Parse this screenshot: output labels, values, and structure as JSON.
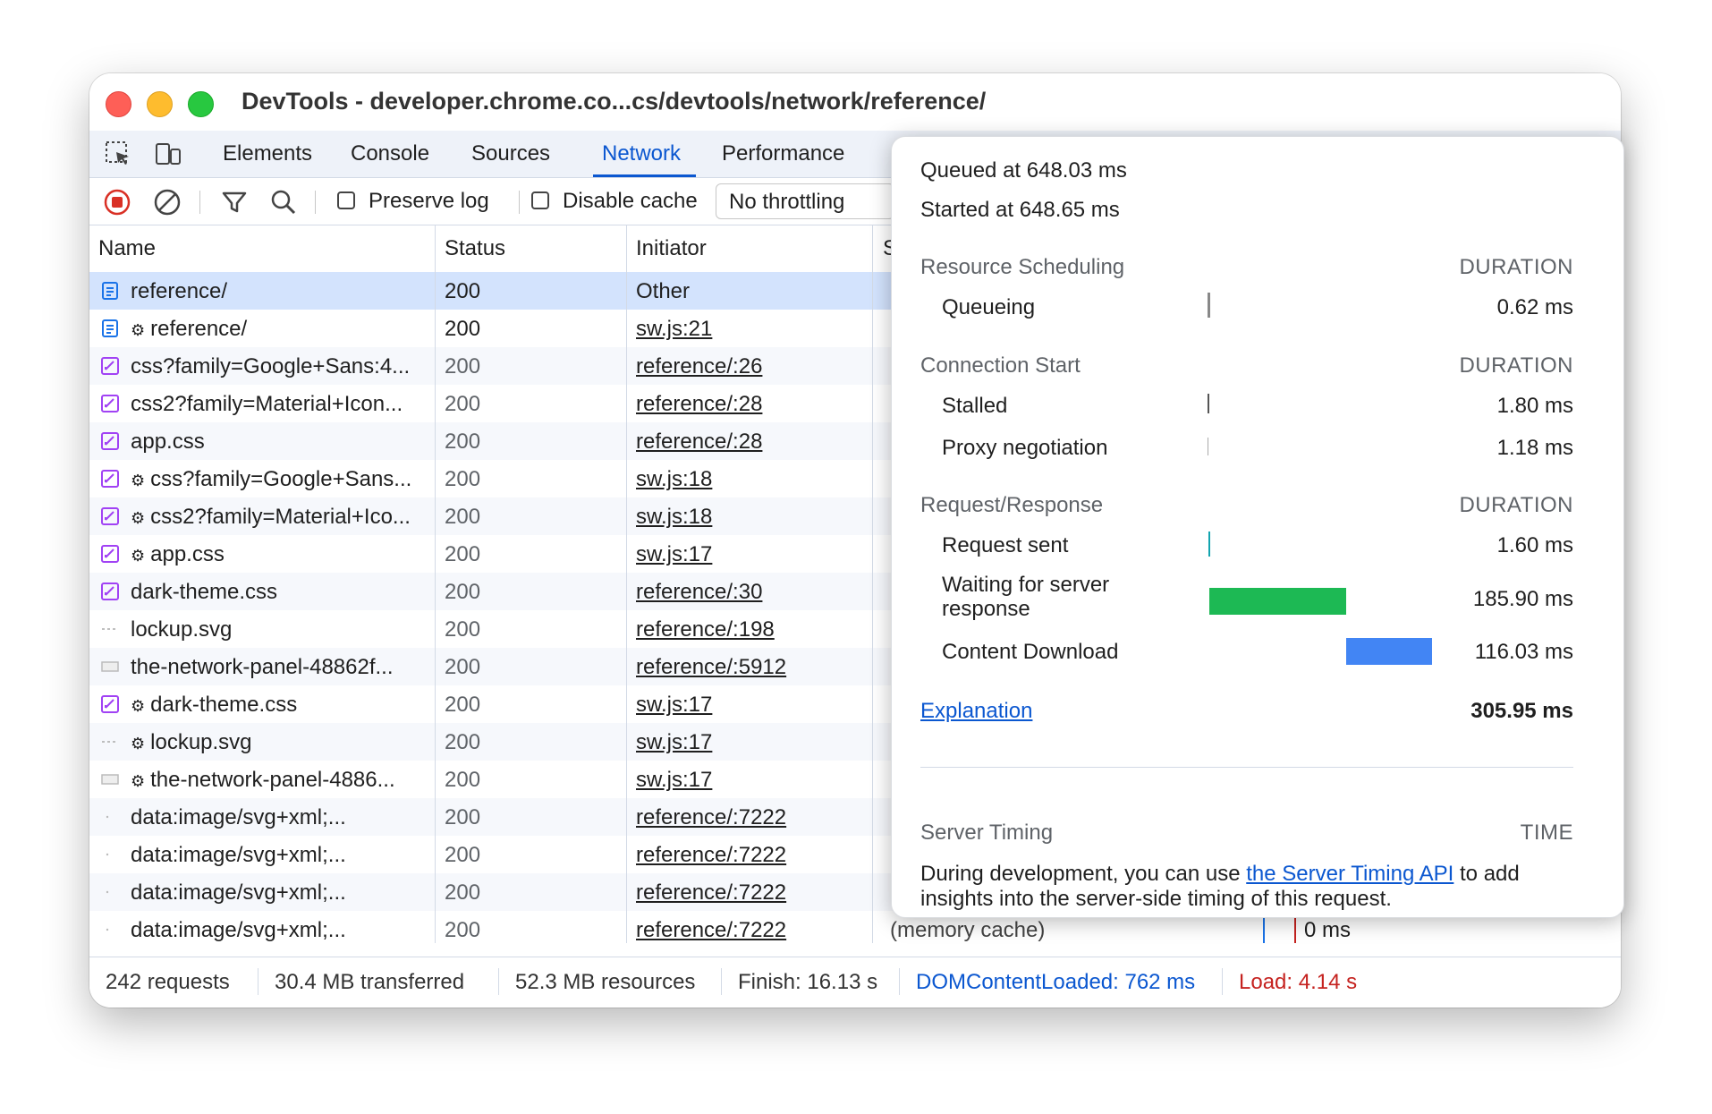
{
  "window": {
    "title": "DevTools - developer.chrome.co...cs/devtools/network/reference/"
  },
  "tabs": [
    "Elements",
    "Console",
    "Sources",
    "Network",
    "Performance"
  ],
  "toolbar": {
    "preserve_log": "Preserve log",
    "disable_cache": "Disable cache",
    "throttling": "No throttling"
  },
  "table": {
    "headers": {
      "name": "Name",
      "status": "Status",
      "initiator": "Initiator",
      "size_partial": "S"
    },
    "rows": [
      {
        "name": "reference/",
        "status": "200",
        "initiator": "Other"
      },
      {
        "name": "reference/",
        "status": "200",
        "initiator": "sw.js:21"
      },
      {
        "name": "css?family=Google+Sans:4...",
        "status": "200",
        "initiator": "reference/:26"
      },
      {
        "name": "css2?family=Material+Icon...",
        "status": "200",
        "initiator": "reference/:28"
      },
      {
        "name": "app.css",
        "status": "200",
        "initiator": "reference/:28"
      },
      {
        "name": "css?family=Google+Sans...",
        "status": "200",
        "initiator": "sw.js:18"
      },
      {
        "name": "css2?family=Material+Ico...",
        "status": "200",
        "initiator": "sw.js:18"
      },
      {
        "name": "app.css",
        "status": "200",
        "initiator": "sw.js:17"
      },
      {
        "name": "dark-theme.css",
        "status": "200",
        "initiator": "reference/:30"
      },
      {
        "name": "lockup.svg",
        "status": "200",
        "initiator": "reference/:198"
      },
      {
        "name": "the-network-panel-48862f...",
        "status": "200",
        "initiator": "reference/:5912"
      },
      {
        "name": "dark-theme.css",
        "status": "200",
        "initiator": "sw.js:17"
      },
      {
        "name": "lockup.svg",
        "status": "200",
        "initiator": "sw.js:17"
      },
      {
        "name": "the-network-panel-4886...",
        "status": "200",
        "initiator": "sw.js:17"
      },
      {
        "name": "data:image/svg+xml;...",
        "status": "200",
        "initiator": "reference/:7222",
        "size": "("
      },
      {
        "name": "data:image/svg+xml;...",
        "status": "200",
        "initiator": "reference/:7222",
        "size": "("
      },
      {
        "name": "data:image/svg+xml;...",
        "status": "200",
        "initiator": "reference/:7222",
        "size": "("
      },
      {
        "name": "data:image/svg+xml;...",
        "status": "200",
        "initiator": "reference/:7222",
        "size": "(memory cache)",
        "time": "0 ms"
      }
    ]
  },
  "statusbar": {
    "requests": "242 requests",
    "transferred": "30.4 MB transferred",
    "resources": "52.3 MB resources",
    "finish": "Finish: 16.13 s",
    "dcl": "DOMContentLoaded: 762 ms",
    "load": "Load: 4.14 s"
  },
  "timing": {
    "queued_at": "Queued at 648.03 ms",
    "started_at": "Started at 648.65 ms",
    "duration_label": "DURATION",
    "sections": {
      "scheduling": "Resource Scheduling",
      "connection": "Connection Start",
      "request": "Request/Response",
      "server": "Server Timing",
      "time_label": "TIME"
    },
    "rows": {
      "queueing": {
        "label": "Queueing",
        "value": "0.62 ms"
      },
      "stalled": {
        "label": "Stalled",
        "value": "1.80 ms"
      },
      "proxy": {
        "label": "Proxy negotiation",
        "value": "1.18 ms"
      },
      "request_sent": {
        "label": "Request sent",
        "value": "1.60 ms"
      },
      "waiting_line1": "Waiting for server",
      "waiting_line2": "response",
      "waiting_value": "185.90 ms",
      "download": {
        "label": "Content Download",
        "value": "116.03 ms"
      }
    },
    "explanation": "Explanation",
    "total": "305.95 ms",
    "server_text_before": "During development, you can use",
    "server_link": "the Server Timing API",
    "server_text_after": "to add",
    "server_text_line2": "insights into the server-side timing of this request."
  },
  "colors": {
    "waiting_bar": "#1db954",
    "download_bar": "#4285f4",
    "request_sent_bar": "#12a4af",
    "accent": "#0b57d0",
    "dcl": "#0b57d0",
    "load": "#c5221f"
  }
}
